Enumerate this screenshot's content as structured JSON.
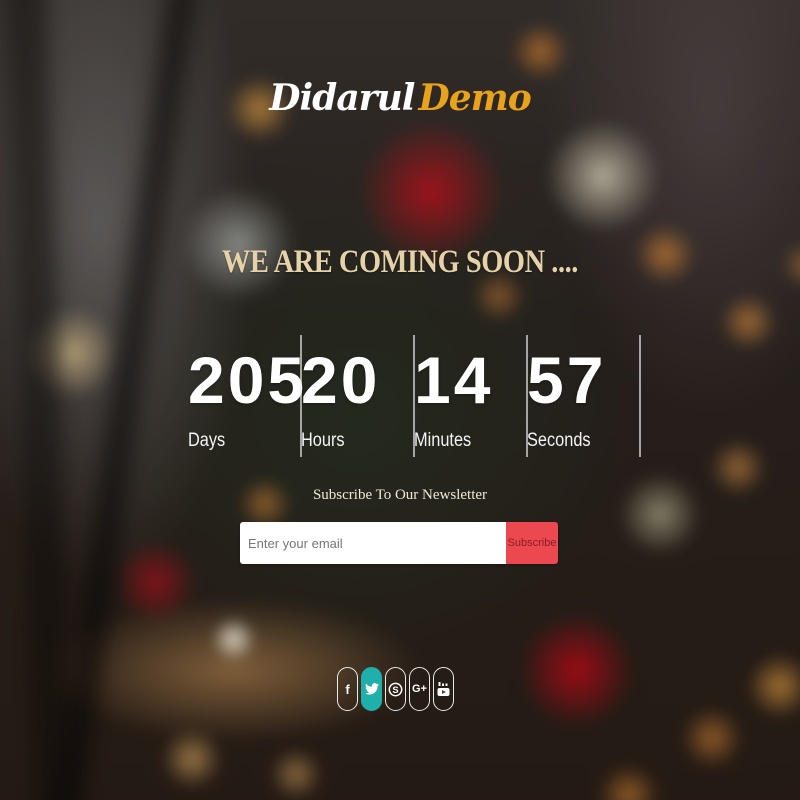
{
  "logo": {
    "first": "Didarul",
    "second": "Demo"
  },
  "headline": "WE ARE COMING SOON ....",
  "countdown": [
    {
      "value": "205",
      "label": "Days"
    },
    {
      "value": "20",
      "label": "Hours"
    },
    {
      "value": "14",
      "label": "Minutes"
    },
    {
      "value": "57",
      "label": "Seconds"
    }
  ],
  "subscribe": {
    "title": "Subscribe To Our Newsletter",
    "placeholder": "Enter your email",
    "button_label": "Subscribe"
  },
  "social": [
    {
      "icon": "facebook-icon",
      "glyph": "f",
      "active": false
    },
    {
      "icon": "twitter-icon",
      "glyph": "",
      "active": true
    },
    {
      "icon": "skype-icon",
      "glyph": "S",
      "active": false
    },
    {
      "icon": "google-plus-icon",
      "glyph": "G+",
      "active": false
    },
    {
      "icon": "youtube-icon",
      "glyph": "",
      "active": false
    }
  ],
  "colors": {
    "logo_accent": "#e8a21c",
    "headline": "#e6d2a8",
    "subscribe_button": "#ec4850",
    "social_active": "#1fb0ac"
  }
}
